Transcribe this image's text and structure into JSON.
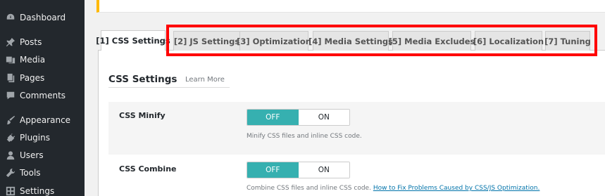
{
  "sidebar": {
    "items": [
      {
        "label": "Dashboard",
        "icon": "dashboard-icon"
      },
      {
        "label": "Posts",
        "icon": "pin-icon"
      },
      {
        "label": "Media",
        "icon": "media-icon"
      },
      {
        "label": "Pages",
        "icon": "pages-icon"
      },
      {
        "label": "Comments",
        "icon": "comment-icon"
      },
      {
        "label": "Appearance",
        "icon": "brush-icon"
      },
      {
        "label": "Plugins",
        "icon": "plugin-icon"
      },
      {
        "label": "Users",
        "icon": "user-icon"
      },
      {
        "label": "Tools",
        "icon": "wrench-icon"
      },
      {
        "label": "Settings",
        "icon": "settings-icon"
      }
    ]
  },
  "tabs": [
    {
      "label": "[1] CSS Settings",
      "active": true
    },
    {
      "label": "[2] JS Settings"
    },
    {
      "label": "[3] Optimization"
    },
    {
      "label": "[4] Media Settings"
    },
    {
      "label": "[5] Media Excludes"
    },
    {
      "label": "[6] Localization"
    },
    {
      "label": "[7] Tuning"
    }
  ],
  "section": {
    "title": "CSS Settings",
    "learn_more": "Learn More"
  },
  "settings": [
    {
      "label": "CSS Minify",
      "off_label": "OFF",
      "on_label": "ON",
      "value": "OFF",
      "description": "Minify CSS files and inline CSS code."
    },
    {
      "label": "CSS Combine",
      "off_label": "OFF",
      "on_label": "ON",
      "value": "OFF",
      "description": "Combine CSS files and inline CSS code.",
      "link_text": "How to Fix Problems Caused by CSS/JS Optimization."
    }
  ],
  "colors": {
    "sidebar_bg": "#23282d",
    "toggle_active": "#36b0b0",
    "highlight": "#ff0000",
    "notice_accent": "#ffb900",
    "link": "#0073aa"
  }
}
